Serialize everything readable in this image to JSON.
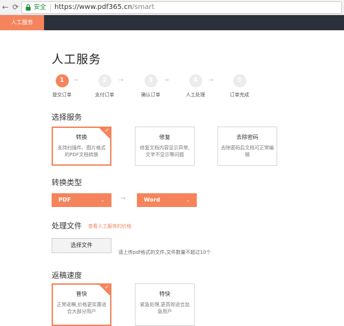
{
  "browser": {
    "back_glyph": "←",
    "reload_glyph": "⟳",
    "secure_label": "安全",
    "url_host": "https://www.pdf365.cn",
    "url_path": "/smart"
  },
  "header": {
    "active_tab": "人工服务"
  },
  "page": {
    "title": "人工服务"
  },
  "steps": [
    {
      "num": "1",
      "label": "提交订单"
    },
    {
      "num": "2",
      "label": "支付订单"
    },
    {
      "num": "3",
      "label": "确认订单"
    },
    {
      "num": "4",
      "label": "人工处理"
    },
    {
      "num": "5",
      "label": "订单完成"
    }
  ],
  "step_arrow": "→",
  "service": {
    "title": "选择服务",
    "cards": [
      {
        "title": "转换",
        "desc": "支持扫描件、图片格式的PDF文档转换"
      },
      {
        "title": "修复",
        "desc": "修复文档内容显示异常,文字不显示等问题"
      },
      {
        "title": "去除密码",
        "desc": "去除密码后文档可正常编辑"
      }
    ]
  },
  "convert": {
    "title": "转换类型",
    "from": "PDF",
    "to": "Word",
    "arrow": "→",
    "caret": "⌄"
  },
  "file": {
    "title": "处理文件",
    "price_link": "查看人工服务的价格",
    "button": "选择文件",
    "hint": "请上传pdf格式的文件,文件数量不超过10个"
  },
  "speed": {
    "title": "返稿速度",
    "cards": [
      {
        "title": "普快",
        "desc": "正常返稿,价格更实惠适合大部分用户"
      },
      {
        "title": "特快",
        "desc": "紧急处理,更高效适合加急用户"
      }
    ]
  },
  "colors": {
    "accent": "#f5845d",
    "header_bg": "#2b313a"
  }
}
